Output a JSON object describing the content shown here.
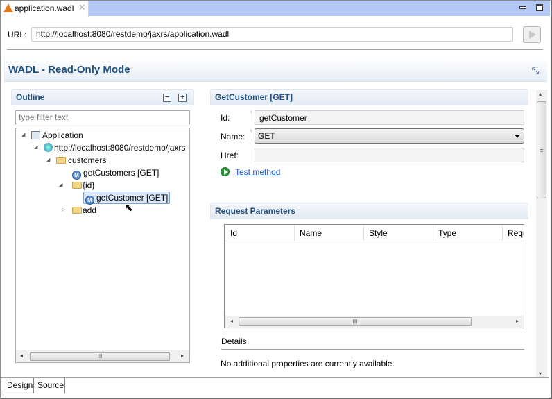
{
  "editor_tab": {
    "title": "application.wadl",
    "icon": "wadl-file-icon",
    "close": "✕"
  },
  "url": {
    "label": "URL:",
    "value": "http://localhost:8080/restdemo/jaxrs/application.wadl",
    "go_icon": "play-icon"
  },
  "page_title": "WADL - Read-Only Mode",
  "outline": {
    "title": "Outline",
    "filter_placeholder": "type filter text",
    "tree": [
      {
        "label": "Application",
        "icon": "application-icon",
        "expanded": true
      },
      {
        "label": "http://localhost:8080/restdemo/jaxrs",
        "icon": "globe-icon",
        "expanded": true
      },
      {
        "label": "customers",
        "icon": "folder-icon",
        "expanded": true
      },
      {
        "label": "getCustomers [GET]",
        "icon": "method-icon"
      },
      {
        "label": "{id}",
        "icon": "folder-icon",
        "expanded": true
      },
      {
        "label": "getCustomer [GET]",
        "icon": "method-icon",
        "selected": true
      },
      {
        "label": "add",
        "icon": "folder-icon",
        "expanded": false
      }
    ]
  },
  "method": {
    "title": "GetCustomer [GET]",
    "id_label": "Id:",
    "id_value": "getCustomer",
    "name_label": "Name:",
    "name_value": "GET",
    "href_label": "Href:",
    "href_value": "",
    "test_link": "Test method"
  },
  "request_params": {
    "title": "Request Parameters",
    "columns": [
      "Id",
      "Name",
      "Style",
      "Type",
      "Requ"
    ],
    "rows": [],
    "details_label": "Details",
    "details_text": "No additional properties are currently available."
  },
  "bottom_tabs": [
    {
      "label": "Design",
      "active": true
    },
    {
      "label": "Source",
      "active": false
    }
  ],
  "colors": {
    "tabbar": "#b4c8f5",
    "header_text": "#1f4f7f",
    "link": "#1a56c8",
    "selection": "#dce9fa"
  }
}
